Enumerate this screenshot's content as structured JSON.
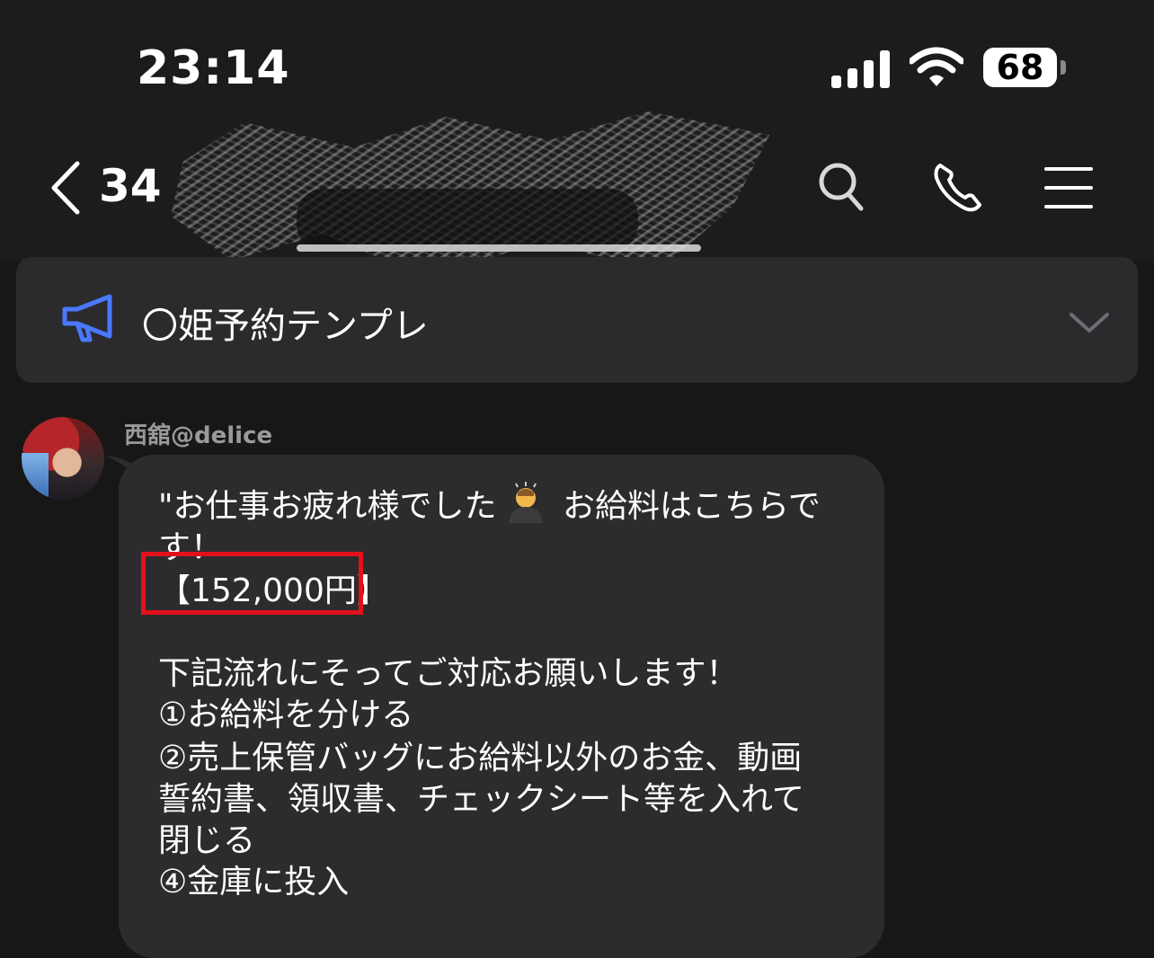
{
  "status_bar": {
    "time": "23:14",
    "battery": "68"
  },
  "nav": {
    "back_count": "34",
    "icons": [
      "back-chevron-icon",
      "search-icon",
      "phone-icon",
      "menu-icon"
    ]
  },
  "announcement": {
    "icon": "megaphone-icon",
    "text": "〇姫予約テンプレ"
  },
  "message": {
    "sender": "西舘@delice",
    "lines": [
      "\"お仕事お疲れ様でした",
      "お給料はこちらで",
      "す！",
      "【152,000円】",
      "下記流れにそってご対応お願いします！",
      "①お給料を分ける",
      "②売上保管バッグにお給料以外のお金、動画",
      "誓約書、領収書、チェックシート等を入れて",
      "閉じる",
      "④金庫に投入"
    ],
    "emoji": "person-bowing-icon"
  },
  "colors": {
    "background": "#171717",
    "bubble": "#2c2c2e",
    "announce_bar": "#2b2b2d",
    "megaphone": "#4a78ff",
    "highlight": "#e3111b",
    "sender": "#9a9a9a"
  }
}
